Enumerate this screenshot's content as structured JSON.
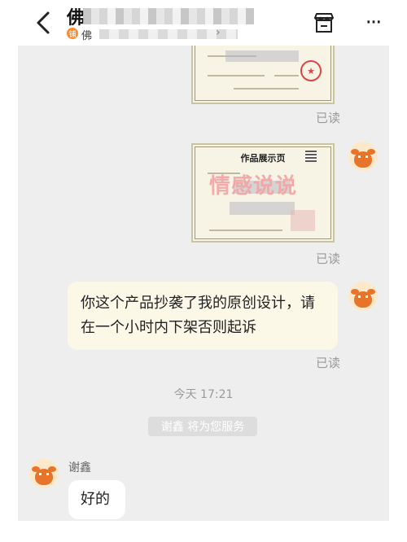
{
  "header": {
    "title": "佛",
    "subtitle": "佛",
    "shop_badge": "铺"
  },
  "messages": {
    "read_label": "已读",
    "cert_title": "作品展示页",
    "watermark": "情感说说",
    "complaint_text": "你这个产品抄袭了我的原创设计，请在一个小时内下架否则起诉",
    "time_label": "今天 17:21",
    "system_notice": "谢鑫 将为您服务",
    "agent_name": "谢鑫",
    "reply_text": "好的"
  },
  "colors": {
    "chat_background": "#eeeeee",
    "outgoing_bubble": "#fbf8e8",
    "incoming_bubble": "#ffffff",
    "watermark": "#f2a4a4",
    "avatar_accent": "#e8742c"
  },
  "icons": [
    "back-arrow-icon",
    "shop-badge-icon",
    "chevron-right-icon",
    "store-icon",
    "more-icon",
    "avatar-icon",
    "seal-icon",
    "qr-code-icon"
  ]
}
